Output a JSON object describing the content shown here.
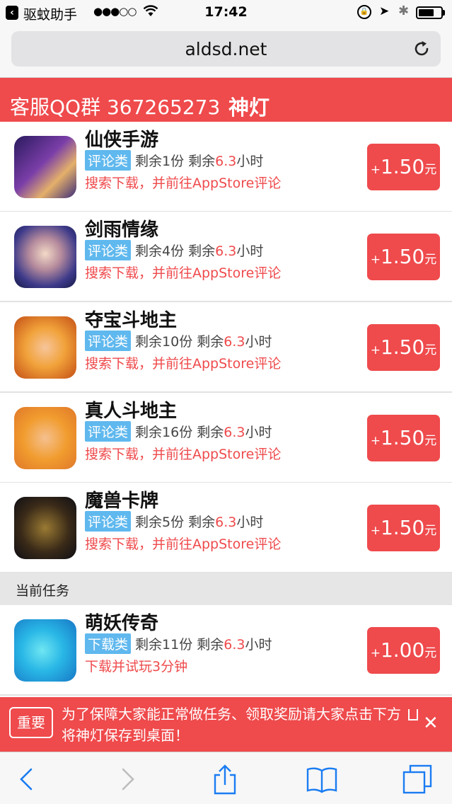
{
  "status_bar": {
    "back_app": "驱蚊助手",
    "signal": "●●●○○",
    "time": "17:42",
    "battery_percent": 70
  },
  "browser": {
    "url": "aldsd.net"
  },
  "header": {
    "qq_group": "客服QQ群 367265273",
    "brand": "神灯"
  },
  "tasks": [
    {
      "name": "仙侠手游",
      "category": "评论类",
      "remaining": "剩余1份",
      "time_prefix": "剩余",
      "hours": "6.3",
      "time_suffix": "小时",
      "hint": "搜索下载，并前往AppStore评论",
      "reward": "1.50",
      "currency": "元",
      "icon": "xianxia-game-icon"
    },
    {
      "name": "剑雨情缘",
      "category": "评论类",
      "remaining": "剩余4份",
      "time_prefix": "剩余",
      "hours": "6.3",
      "time_suffix": "小时",
      "hint": "搜索下载，并前往AppStore评论",
      "reward": "1.50",
      "currency": "元",
      "icon": "jianyu-game-icon"
    },
    {
      "name": "夺宝斗地主",
      "category": "评论类",
      "remaining": "剩余10份",
      "time_prefix": "剩余",
      "hours": "6.3",
      "time_suffix": "小时",
      "hint": "搜索下载，并前往AppStore评论",
      "reward": "1.50",
      "currency": "元",
      "icon": "duobao-doudizhu-icon"
    },
    {
      "name": "真人斗地主",
      "category": "评论类",
      "remaining": "剩余16份",
      "time_prefix": "剩余",
      "hours": "6.3",
      "time_suffix": "小时",
      "hint": "搜索下载，并前往AppStore评论",
      "reward": "1.50",
      "currency": "元",
      "icon": "zhenren-doudizhu-icon"
    },
    {
      "name": "魔兽卡牌",
      "category": "评论类",
      "remaining": "剩余5份",
      "time_prefix": "剩余",
      "hours": "6.3",
      "time_suffix": "小时",
      "hint": "搜索下载，并前往AppStore评论",
      "reward": "1.50",
      "currency": "元",
      "icon": "moshou-card-icon"
    }
  ],
  "section_label": "当前任务",
  "current_tasks": [
    {
      "name": "萌妖传奇",
      "category": "下载类",
      "remaining": "剩余11份",
      "time_prefix": "剩余",
      "hours": "6.3",
      "time_suffix": "小时",
      "hint": "下载并试玩3分钟",
      "reward": "1.00",
      "currency": "元",
      "icon": "mengyao-game-icon"
    }
  ],
  "notice": {
    "tag": "重要",
    "text_before": "为了保障大家能正常做任务、领取奖励请大家点击下方",
    "text_after": "将神灯保存到桌面！"
  },
  "colors": {
    "accent_red": "#ef4a4c",
    "badge_blue": "#5fb8ee",
    "ios_blue": "#1a7cf2"
  }
}
